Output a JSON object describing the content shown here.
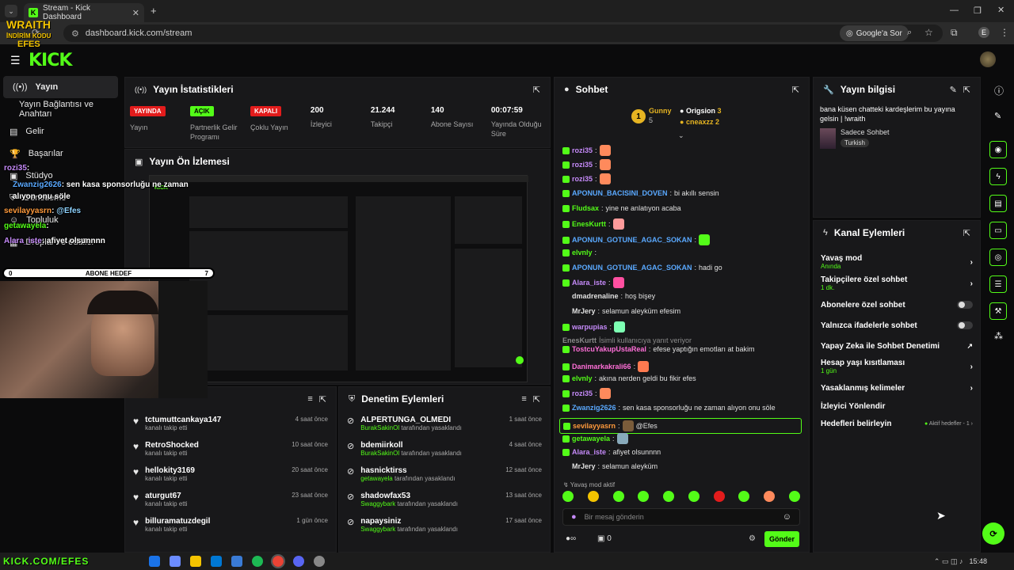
{
  "browser": {
    "tab_title": "Stream - Kick Dashboard",
    "url": "dashboard.kick.com/stream",
    "google_btn": "Google'a Sor",
    "profile_initial": "E"
  },
  "colors": {
    "brand": "#53fc18",
    "danger": "#e31c1c",
    "panel": "#18181a"
  },
  "sidebar": {
    "items": [
      {
        "label": "Yayın",
        "icon": "broadcast-icon"
      },
      {
        "label": "Yayın Bağlantısı ve Anahtarı",
        "icon": "none"
      },
      {
        "label": "Gelir",
        "icon": "money-icon"
      },
      {
        "label": "Başarılar",
        "icon": "trophy-icon"
      },
      {
        "label": "Stüdyo",
        "icon": "studio-icon"
      },
      {
        "label": "Denetleme",
        "icon": "shield-icon"
      },
      {
        "label": "Topluluk",
        "icon": "community-icon"
      },
      {
        "label": "Droplar ve ödüller",
        "icon": "gift-icon"
      }
    ]
  },
  "stats": {
    "title": "Yayın İstatistikleri",
    "items": [
      {
        "badge": "YAYINDA",
        "label": "Yayın"
      },
      {
        "badge": "AÇIK",
        "label": "Partnerlik Gelir Programı"
      },
      {
        "badge": "KAPALI",
        "label": "Çoklu Yayın"
      },
      {
        "value": "200",
        "label": "İzleyici"
      },
      {
        "value": "21.244",
        "label": "Takipçi"
      },
      {
        "value": "140",
        "label": "Abone Sayısı"
      },
      {
        "value": "00:07:59",
        "label": "Yayında Olduğu Süre"
      }
    ]
  },
  "preview": {
    "title": "Yayın Ön İzlemesi"
  },
  "follows": {
    "rows": [
      {
        "name": "tctumuttcankaya147",
        "sub": "kanalı takip etti",
        "time": "4 saat önce"
      },
      {
        "name": "RetroShocked",
        "sub": "kanalı takip etti",
        "time": "10 saat önce"
      },
      {
        "name": "hellokity3169",
        "sub": "kanalı takip etti",
        "time": "20 saat önce"
      },
      {
        "name": "aturgut67",
        "sub": "kanalı takip etti",
        "time": "23 saat önce"
      },
      {
        "name": "billuramatuzdegil",
        "sub": "kanalı takip etti",
        "time": "1 gün önce"
      }
    ]
  },
  "modactions": {
    "title": "Denetim Eylemleri",
    "rows": [
      {
        "name": "ALPERTUNGA_OLMEDI",
        "by": "BurakSakinOl",
        "action": "tarafından yasaklandı",
        "time": "1 saat önce"
      },
      {
        "name": "bdemiirkoll",
        "by": "BurakSakinOl",
        "action": "tarafından yasaklandı",
        "time": "4 saat önce"
      },
      {
        "name": "hasnicktirss",
        "by": "getawayela",
        "action": "tarafından yasaklandı",
        "time": "12 saat önce"
      },
      {
        "name": "shadowfax53",
        "by": "Swaggybark",
        "action": "tarafından yasaklandı",
        "time": "13 saat önce"
      },
      {
        "name": "napaysiniz",
        "by": "Swaggybark",
        "action": "tarafından yasaklandı",
        "time": "17 saat önce"
      }
    ]
  },
  "chat": {
    "title": "Sohbet",
    "top": {
      "first": "Gunny",
      "first_count": "5",
      "second": "Origsion",
      "second_count": "3",
      "third": "cneaxzz",
      "third_count": "2",
      "rank": "1"
    },
    "messages": [
      {
        "user": "rozi35",
        "text": "",
        "color": "#c58af9"
      },
      {
        "user": "rozi35",
        "text": "",
        "color": "#c58af9"
      },
      {
        "user": "rozi35",
        "text": "",
        "color": "#c58af9"
      },
      {
        "user": "APONUN_BACISINI_DOVEN",
        "text": "bi akıllı sensin",
        "color": "#5aa9ff"
      },
      {
        "user": "Fludsax",
        "text": "yine ne anlatıyon acaba",
        "color": "#53fc18"
      },
      {
        "user": "EnesKurtt",
        "text": "",
        "color": "#53fc18"
      },
      {
        "user": "APONUN_GOTUNE_AGAC_SOKAN",
        "text": "",
        "color": "#5aa9ff"
      },
      {
        "user": "elvnly",
        "text": "",
        "color": "#53fc18"
      },
      {
        "user": "APONUN_GOTUNE_AGAC_SOKAN",
        "text": "hadi go",
        "color": "#5aa9ff"
      },
      {
        "user": "Alara_iste",
        "text": "",
        "color": "#c58af9"
      },
      {
        "user": "dmadrenaline",
        "text": "hoş bişey",
        "color": "#e0e0e0"
      },
      {
        "user": "MrJery",
        "text": "selamun aleyküm efesim",
        "color": "#e0e0e0"
      },
      {
        "user": "warpupias",
        "text": "",
        "color": "#c58af9"
      },
      {
        "user": "EnesKurtt",
        "text": "İsimli kullanıcıya yanıt veriyor",
        "color": "#8a8a8a"
      },
      {
        "user": "TostcuYakupUstaReal",
        "text": "efese yaptığın emotları at bakim",
        "color": "#ff6fd8"
      },
      {
        "user": "Danimarkakrali66",
        "text": "",
        "color": "#ff6fd8"
      },
      {
        "user": "elvnly",
        "text": "akına nerden geldi bu fikir efes",
        "color": "#53fc18"
      },
      {
        "user": "rozi35",
        "text": "",
        "color": "#c58af9"
      },
      {
        "user": "Zwanzig2626",
        "text": "sen kasa sponsorluğu ne zaman alıyon onu söle",
        "color": "#5aa9ff"
      },
      {
        "user": "sevilayyasrn",
        "text": "@Efes",
        "color": "#ff9a3c"
      },
      {
        "user": "getawayela",
        "text": "",
        "color": "#53fc18"
      },
      {
        "user": "Alara_iste",
        "text": "afiyet olsunnnn",
        "color": "#c58af9"
      },
      {
        "user": "MrJery",
        "text": "selamun aleyküm",
        "color": "#e0e0e0"
      }
    ],
    "slow_mode": "Yavaş mod aktif",
    "input_placeholder": "Bir mesaj gönderin",
    "send_label": "Gönder",
    "footer_count": "0"
  },
  "info": {
    "title": "Yayın bilgisi",
    "desc": "bana küsen chatteki kardeşlerim bu yayına gelsin | !wraith",
    "category": "Sadece Sohbet",
    "tag": "Turkish"
  },
  "channel_actions": {
    "title": "Kanal Eylemleri",
    "items": [
      {
        "label": "Yavaş mod",
        "sub": "Anında",
        "ctrl": "chevron"
      },
      {
        "label": "Takipçilere özel sohbet",
        "sub": "1 dk.",
        "ctrl": "chevron"
      },
      {
        "label": "Abonelere özel sohbet",
        "sub": "",
        "ctrl": "toggle"
      },
      {
        "label": "Yalnızca ifadelerle sohbet",
        "sub": "",
        "ctrl": "toggle"
      },
      {
        "label": "Yapay Zeka ile Sohbet Denetimi",
        "sub": "",
        "ctrl": "link"
      },
      {
        "label": "Hesap yaşı kısıtlaması",
        "sub": "1 gün",
        "ctrl": "chevron"
      },
      {
        "label": "Yasaklanmış kelimeler",
        "sub": "",
        "ctrl": "chevron"
      },
      {
        "label": "İzleyici Yönlendir",
        "sub": "",
        "ctrl": "none"
      },
      {
        "label": "Hedefleri belirleyin",
        "sub": "",
        "ctrl": "goal"
      }
    ],
    "goal_status": "Aktif hedefler - 1"
  },
  "overlay": {
    "brand_top": "WRAITH",
    "brand_sub": "İNDİRİM KODU",
    "brand_name": "EFES",
    "sub_goal_left": "0",
    "sub_goal_label": "ABONE HEDEF",
    "sub_goal_right": "7",
    "chat": [
      {
        "user": "rozi35",
        "text": ":"
      },
      {
        "user": "Zwanzig2626",
        "text": ": sen kasa sponsorluğu ne zaman alıyon onu söle"
      },
      {
        "user": "sevilayyasrn",
        "text": ":"
      },
      {
        "user": "getawayela",
        "text": ":"
      },
      {
        "user": "Alara_iste",
        "text": ": afiyet olsunnnn"
      }
    ],
    "mention": "@Efes",
    "bottom_url": "KICK.COM/EFES"
  },
  "taskbar": {
    "time": "15:48"
  }
}
